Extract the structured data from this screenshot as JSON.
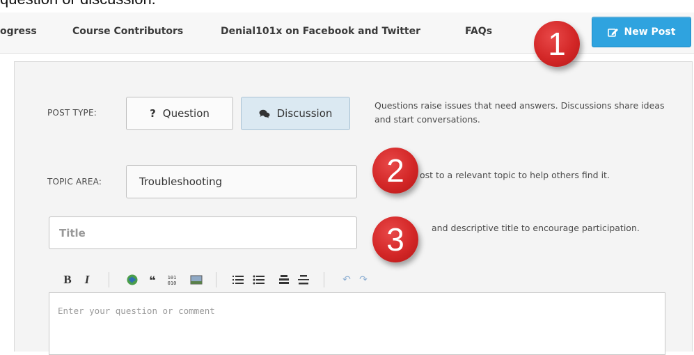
{
  "caption": "question or discussion.",
  "nav": {
    "items": [
      "ogress",
      "Course Contributors",
      "Denial101x on Facebook and Twitter",
      "FAQs"
    ],
    "new_post": "New Post",
    "new_post_icon": "edit-icon"
  },
  "post_type": {
    "label": "POST TYPE:",
    "question": "Question",
    "question_icon": "question-mark-icon",
    "discussion": "Discussion",
    "discussion_icon": "speech-bubbles-icon",
    "description": "Questions raise issues that need answers. Discussions share ideas and start conversations."
  },
  "topic": {
    "label": "TOPIC AREA:",
    "value": "Troubleshooting",
    "description": "ost to a relevant topic to help others find it."
  },
  "title_field": {
    "placeholder": "Title",
    "description": "and descriptive title to encourage participation."
  },
  "toolbar": {
    "bold": "B",
    "italic": "I",
    "icons": [
      "link-icon",
      "blockquote-icon",
      "code-icon",
      "image-icon",
      "numbered-list-icon",
      "bulleted-list-icon",
      "heading-icon",
      "horizontal-rule-icon",
      "undo-icon",
      "redo-icon"
    ]
  },
  "editor": {
    "placeholder": "Enter your question or comment"
  },
  "markers": [
    "1",
    "2",
    "3"
  ],
  "colors": {
    "accent": "#2fa3df",
    "marker": "#d32727",
    "selected": "#dbe9f2"
  }
}
